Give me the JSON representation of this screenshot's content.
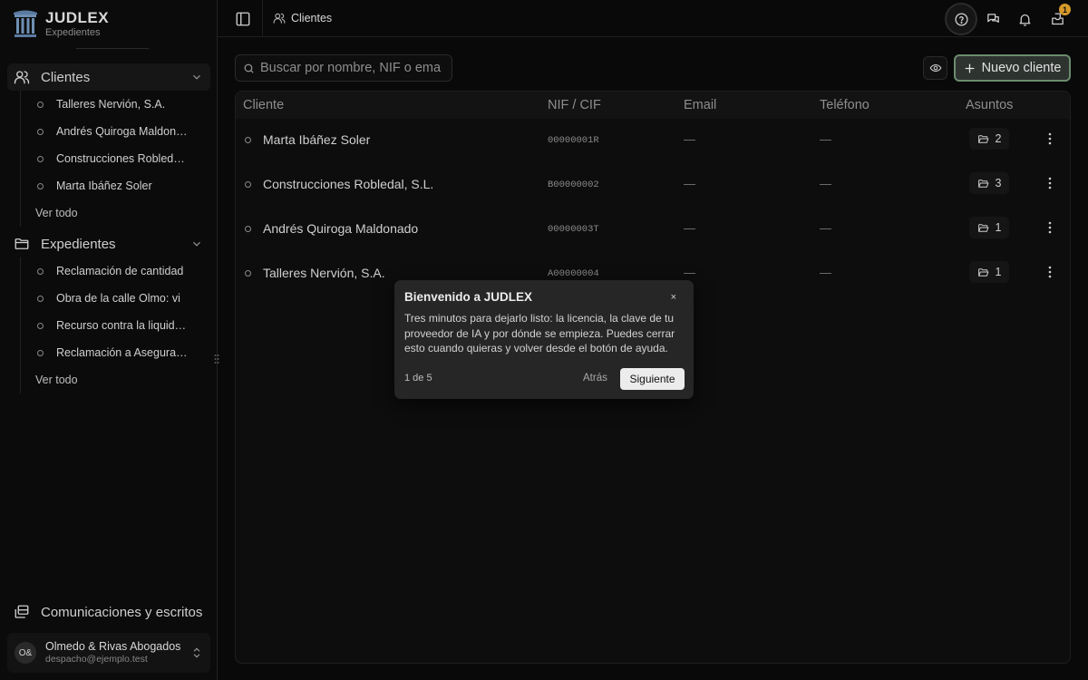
{
  "brand": {
    "name": "JUDLEX",
    "subtitle": "Expedientes"
  },
  "sidebar": {
    "clientes": {
      "label": "Clientes",
      "items": [
        "Talleres Nervión, S.A.",
        "Andrés Quiroga Maldonado",
        "Construcciones Robledal, S.L.",
        "Marta Ibáñez Soler"
      ],
      "see_all": "Ver todo"
    },
    "expedientes": {
      "label": "Expedientes",
      "items": [
        "Reclamación de cantidad",
        "Obra de la calle Olmo: vi",
        "Recurso contra la liquidación",
        "Reclamación a Aseguradora"
      ],
      "see_all": "Ver todo"
    },
    "comunicaciones": "Comunicaciones y escritos",
    "account": {
      "initials": "O&",
      "name": "Olmedo & Rivas Abogados",
      "email": "despacho@ejemplo.test"
    }
  },
  "topbar": {
    "breadcrumb": "Clientes",
    "notifications_badge": "1"
  },
  "toolbar": {
    "search_placeholder": "Buscar por nombre, NIF o email.",
    "new_button": "Nuevo cliente"
  },
  "table": {
    "columns": [
      "Cliente",
      "NIF / CIF",
      "Email",
      "Teléfono",
      "Asuntos"
    ],
    "rows": [
      {
        "name": "Marta Ibáñez Soler",
        "nif": "00000001R",
        "email": "—",
        "phone": "—",
        "asuntos": "2"
      },
      {
        "name": "Construcciones Robledal, S.L.",
        "nif": "B00000002",
        "email": "—",
        "phone": "—",
        "asuntos": "3"
      },
      {
        "name": "Andrés Quiroga Maldonado",
        "nif": "00000003T",
        "email": "—",
        "phone": "—",
        "asuntos": "1"
      },
      {
        "name": "Talleres Nervión, S.A.",
        "nif": "A00000004",
        "email": "—",
        "phone": "—",
        "asuntos": "1"
      }
    ]
  },
  "tour": {
    "title": "Bienvenido a JUDLEX",
    "close": "×",
    "body": "Tres minutos para dejarlo listo: la licencia, la clave de tu proveedor de IA y por dónde se empieza. Puedes cerrar esto cuando quieras y volver desde el botón de ayuda.",
    "step": "1 de 5",
    "back": "Atrás",
    "next": "Siguiente"
  },
  "colors": {
    "accent_border": "#6b8c6f",
    "badge": "#d79a2a"
  }
}
